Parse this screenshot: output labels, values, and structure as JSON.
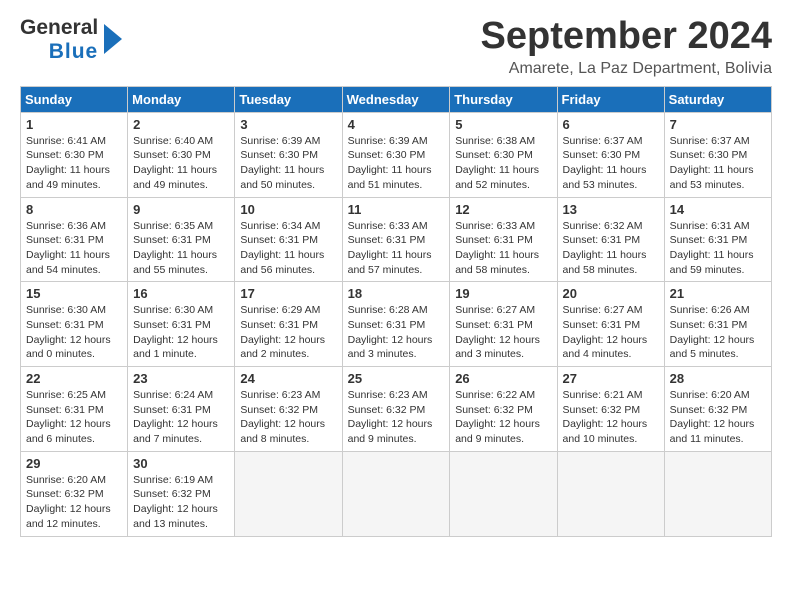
{
  "header": {
    "logo_line1": "General",
    "logo_line2": "Blue",
    "month": "September 2024",
    "location": "Amarete, La Paz Department, Bolivia"
  },
  "days_of_week": [
    "Sunday",
    "Monday",
    "Tuesday",
    "Wednesday",
    "Thursday",
    "Friday",
    "Saturday"
  ],
  "weeks": [
    [
      {
        "day": "1",
        "info": "Sunrise: 6:41 AM\nSunset: 6:30 PM\nDaylight: 11 hours\nand 49 minutes."
      },
      {
        "day": "2",
        "info": "Sunrise: 6:40 AM\nSunset: 6:30 PM\nDaylight: 11 hours\nand 49 minutes."
      },
      {
        "day": "3",
        "info": "Sunrise: 6:39 AM\nSunset: 6:30 PM\nDaylight: 11 hours\nand 50 minutes."
      },
      {
        "day": "4",
        "info": "Sunrise: 6:39 AM\nSunset: 6:30 PM\nDaylight: 11 hours\nand 51 minutes."
      },
      {
        "day": "5",
        "info": "Sunrise: 6:38 AM\nSunset: 6:30 PM\nDaylight: 11 hours\nand 52 minutes."
      },
      {
        "day": "6",
        "info": "Sunrise: 6:37 AM\nSunset: 6:30 PM\nDaylight: 11 hours\nand 53 minutes."
      },
      {
        "day": "7",
        "info": "Sunrise: 6:37 AM\nSunset: 6:30 PM\nDaylight: 11 hours\nand 53 minutes."
      }
    ],
    [
      {
        "day": "8",
        "info": "Sunrise: 6:36 AM\nSunset: 6:31 PM\nDaylight: 11 hours\nand 54 minutes."
      },
      {
        "day": "9",
        "info": "Sunrise: 6:35 AM\nSunset: 6:31 PM\nDaylight: 11 hours\nand 55 minutes."
      },
      {
        "day": "10",
        "info": "Sunrise: 6:34 AM\nSunset: 6:31 PM\nDaylight: 11 hours\nand 56 minutes."
      },
      {
        "day": "11",
        "info": "Sunrise: 6:33 AM\nSunset: 6:31 PM\nDaylight: 11 hours\nand 57 minutes."
      },
      {
        "day": "12",
        "info": "Sunrise: 6:33 AM\nSunset: 6:31 PM\nDaylight: 11 hours\nand 58 minutes."
      },
      {
        "day": "13",
        "info": "Sunrise: 6:32 AM\nSunset: 6:31 PM\nDaylight: 11 hours\nand 58 minutes."
      },
      {
        "day": "14",
        "info": "Sunrise: 6:31 AM\nSunset: 6:31 PM\nDaylight: 11 hours\nand 59 minutes."
      }
    ],
    [
      {
        "day": "15",
        "info": "Sunrise: 6:30 AM\nSunset: 6:31 PM\nDaylight: 12 hours\nand 0 minutes."
      },
      {
        "day": "16",
        "info": "Sunrise: 6:30 AM\nSunset: 6:31 PM\nDaylight: 12 hours\nand 1 minute."
      },
      {
        "day": "17",
        "info": "Sunrise: 6:29 AM\nSunset: 6:31 PM\nDaylight: 12 hours\nand 2 minutes."
      },
      {
        "day": "18",
        "info": "Sunrise: 6:28 AM\nSunset: 6:31 PM\nDaylight: 12 hours\nand 3 minutes."
      },
      {
        "day": "19",
        "info": "Sunrise: 6:27 AM\nSunset: 6:31 PM\nDaylight: 12 hours\nand 3 minutes."
      },
      {
        "day": "20",
        "info": "Sunrise: 6:27 AM\nSunset: 6:31 PM\nDaylight: 12 hours\nand 4 minutes."
      },
      {
        "day": "21",
        "info": "Sunrise: 6:26 AM\nSunset: 6:31 PM\nDaylight: 12 hours\nand 5 minutes."
      }
    ],
    [
      {
        "day": "22",
        "info": "Sunrise: 6:25 AM\nSunset: 6:31 PM\nDaylight: 12 hours\nand 6 minutes."
      },
      {
        "day": "23",
        "info": "Sunrise: 6:24 AM\nSunset: 6:31 PM\nDaylight: 12 hours\nand 7 minutes."
      },
      {
        "day": "24",
        "info": "Sunrise: 6:23 AM\nSunset: 6:32 PM\nDaylight: 12 hours\nand 8 minutes."
      },
      {
        "day": "25",
        "info": "Sunrise: 6:23 AM\nSunset: 6:32 PM\nDaylight: 12 hours\nand 9 minutes."
      },
      {
        "day": "26",
        "info": "Sunrise: 6:22 AM\nSunset: 6:32 PM\nDaylight: 12 hours\nand 9 minutes."
      },
      {
        "day": "27",
        "info": "Sunrise: 6:21 AM\nSunset: 6:32 PM\nDaylight: 12 hours\nand 10 minutes."
      },
      {
        "day": "28",
        "info": "Sunrise: 6:20 AM\nSunset: 6:32 PM\nDaylight: 12 hours\nand 11 minutes."
      }
    ],
    [
      {
        "day": "29",
        "info": "Sunrise: 6:20 AM\nSunset: 6:32 PM\nDaylight: 12 hours\nand 12 minutes."
      },
      {
        "day": "30",
        "info": "Sunrise: 6:19 AM\nSunset: 6:32 PM\nDaylight: 12 hours\nand 13 minutes."
      },
      {
        "day": "",
        "info": ""
      },
      {
        "day": "",
        "info": ""
      },
      {
        "day": "",
        "info": ""
      },
      {
        "day": "",
        "info": ""
      },
      {
        "day": "",
        "info": ""
      }
    ]
  ]
}
